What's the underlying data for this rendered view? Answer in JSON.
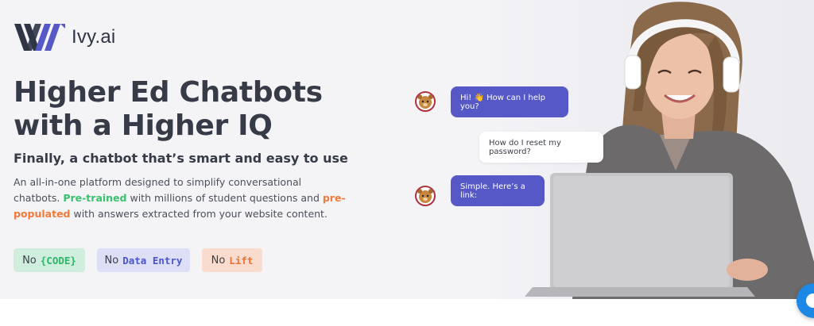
{
  "logo": {
    "text": "Ivy.ai"
  },
  "hero": {
    "headline_line1": "Higher Ed Chatbots",
    "headline_line2": "with a Higher IQ",
    "subheadline": "Finally, a chatbot that’s smart and easy to use",
    "description": {
      "part1": "An all-in-one platform designed to simplify conversational chatbots.",
      "pretrained": "Pre-trained",
      "part2": " with millions of student questions and ",
      "prepopulated": "pre-populated",
      "part3": " with answers extracted from your website content."
    },
    "pills": [
      {
        "prefix": "No",
        "value": "{CODE}"
      },
      {
        "prefix": "No",
        "value": "Data Entry"
      },
      {
        "prefix": "No",
        "value": "Lift"
      }
    ]
  },
  "chat": {
    "bot_message_1": "Hi! 👋  How can I help you?",
    "user_message_1": "How do I reset my password?",
    "bot_message_2": "Simple. Here’s a link:"
  },
  "colors": {
    "bot_bubble": "#5558c6",
    "accent_green": "#38c26f",
    "accent_orange": "#f07a3a",
    "accent_blue": "#4a55c9",
    "chat_launcher": "#1d88e5"
  },
  "icons": [
    "ivy-logo-icon",
    "mascot-avatar-icon",
    "chat-launcher-icon"
  ]
}
